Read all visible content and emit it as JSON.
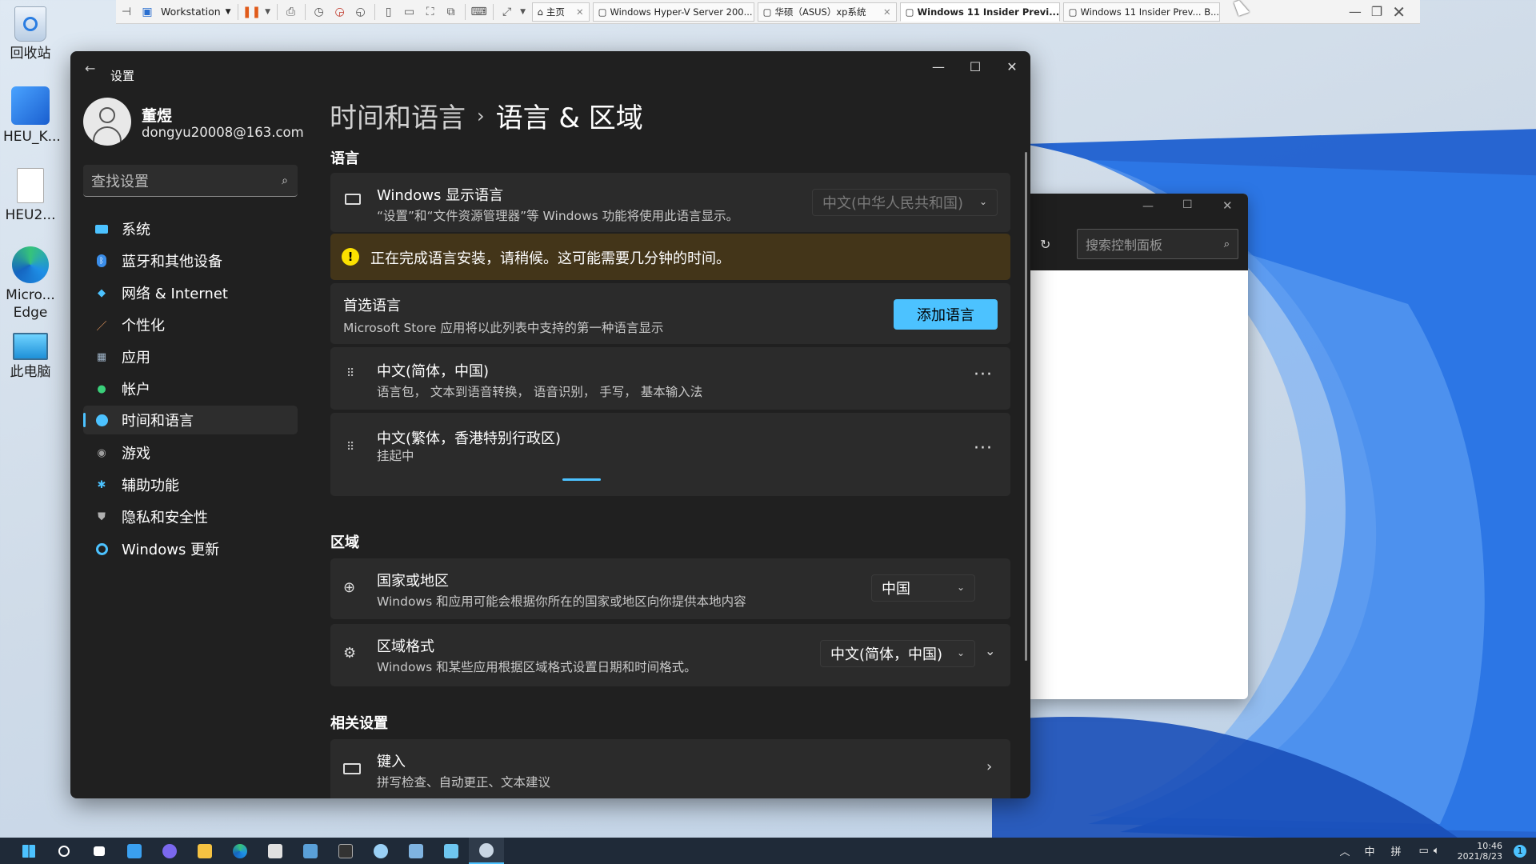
{
  "desktop": {
    "icons": [
      {
        "label": "回收站",
        "icon": "recycle-bin-icon"
      },
      {
        "label": "HEU_K...",
        "icon": "installer-icon"
      },
      {
        "label": "HEU2...",
        "icon": "document-icon"
      },
      {
        "label": "Micro... Edge",
        "icon": "edge-icon"
      },
      {
        "label": "此电脑",
        "icon": "computer-icon"
      }
    ]
  },
  "vm_toolbar": {
    "workstation_label": "Workstation",
    "tabs": [
      {
        "label": "主页"
      },
      {
        "label": "Windows Hyper-V Server 200..."
      },
      {
        "label": "华硕（ASUS）xp系统"
      },
      {
        "label": "Windows 11 Insider Previ..."
      },
      {
        "label": "Windows 11 Insider Prev... B..."
      }
    ]
  },
  "settings": {
    "window_title": "设置",
    "user": {
      "name": "董煜",
      "email": "dongyu20008@163.com"
    },
    "search_placeholder": "查找设置",
    "nav": [
      {
        "label": "系统",
        "icon": "display-icon",
        "color": "#4cc2ff"
      },
      {
        "label": "蓝牙和其他设备",
        "icon": "bluetooth-icon",
        "color": "#3b8eea"
      },
      {
        "label": "网络 & Internet",
        "icon": "wifi-icon",
        "color": "#4cc2ff"
      },
      {
        "label": "个性化",
        "icon": "brush-icon",
        "color": "#f0a060"
      },
      {
        "label": "应用",
        "icon": "apps-icon",
        "color": "#9fb4c8"
      },
      {
        "label": "帐户",
        "icon": "person-icon",
        "color": "#3ad07a"
      },
      {
        "label": "时间和语言",
        "icon": "globe-clock-icon",
        "color": "#4cc2ff"
      },
      {
        "label": "游戏",
        "icon": "gamepad-icon",
        "color": "#a0a0a0"
      },
      {
        "label": "辅助功能",
        "icon": "accessibility-icon",
        "color": "#4cc2ff"
      },
      {
        "label": "隐私和安全性",
        "icon": "shield-icon",
        "color": "#b0b0b0"
      },
      {
        "label": "Windows 更新",
        "icon": "update-icon",
        "color": "#4cc2ff"
      }
    ],
    "selected_nav": "时间和语言",
    "breadcrumb": {
      "parent": "时间和语言",
      "separator": "›",
      "current": "语言 & 区域"
    },
    "section_language": "语言",
    "display_language": {
      "title": "Windows 显示语言",
      "desc": "“设置”和“文件资源管理器”等 Windows 功能将使用此语言显示。",
      "value": "中文(中华人民共和国)"
    },
    "warning": "正在完成语言安装，请稍候。这可能需要几分钟的时间。",
    "preferred": {
      "title": "首选语言",
      "desc": "Microsoft Store 应用将以此列表中支持的第一种语言显示",
      "button": "添加语言"
    },
    "languages": [
      {
        "name": "中文(简体，中国)",
        "detail": "语言包， 文本到语音转换， 语音识别， 手写， 基本输入法"
      },
      {
        "name": "中文(繁体，香港特别行政区)",
        "detail": "挂起中"
      }
    ],
    "section_region": "区域",
    "country": {
      "title": "国家或地区",
      "desc": "Windows 和应用可能会根据你所在的国家或地区向你提供本地内容",
      "value": "中国"
    },
    "regional_format": {
      "title": "区域格式",
      "desc": "Windows 和某些应用根据区域格式设置日期和时间格式。",
      "value": "中文(简体，中国)"
    },
    "section_related": "相关设置",
    "typing": {
      "title": "键入",
      "desc": "拼写检查、自动更正、文本建议"
    }
  },
  "control_panel": {
    "search_placeholder": "搜索控制面板"
  },
  "taskbar": {
    "tray": {
      "ime1": "中",
      "ime2": "拼",
      "time": "10:46",
      "date": "2021/8/23",
      "notify_count": "1"
    }
  },
  "colors": {
    "accent": "#4cc2ff",
    "warning_bg": "#433519",
    "warning_icon": "#fce100",
    "window_bg": "#202020",
    "card_bg": "#2b2b2b"
  }
}
